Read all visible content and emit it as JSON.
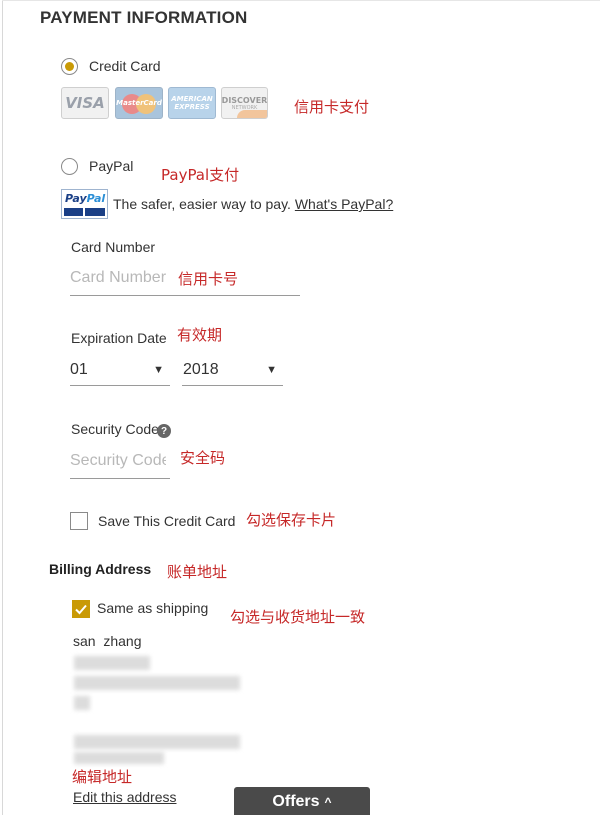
{
  "section_title": "PAYMENT INFORMATION",
  "payment_options": {
    "credit_card_label": "Credit Card",
    "paypal_label": "PayPal",
    "selected": "Credit Card"
  },
  "card_logos": {
    "visa": "VISA",
    "mastercard": "MasterCard",
    "amex_line1": "AMERICAN",
    "amex_line2": "EXPRESS",
    "discover": "DISCOVER",
    "discover_sub": "NETWORK"
  },
  "paypal": {
    "logo_text_1": "Pay",
    "logo_text_2": "Pal",
    "tagline": "The safer, easier way to pay.",
    "whats_link": "What's PayPal?"
  },
  "annotations": {
    "credit_card_pay": "信用卡支付",
    "paypal_pay": "PayPal支付",
    "card_number": "信用卡号",
    "expiry": "有效期",
    "security_code": "安全码",
    "save_card": "勾选保存卡片",
    "billing": "账单地址",
    "same_as_shipping": "勾选与收货地址一致",
    "edit_address": "编辑地址"
  },
  "card_number": {
    "label": "Card Number",
    "placeholder": "Card Number"
  },
  "expiration": {
    "label": "Expiration Date",
    "month": "01",
    "year": "2018"
  },
  "security_code": {
    "label": "Security Code",
    "help": "?",
    "placeholder": "Security Code"
  },
  "save_card": {
    "label": "Save This Credit Card",
    "checked": false
  },
  "billing": {
    "title": "Billing Address",
    "same_as_shipping_label": "Same as shipping",
    "same_as_shipping_checked": true,
    "name": "san  zhang",
    "edit_link": "Edit this address"
  },
  "offers": {
    "label": "Offers",
    "caret": "^"
  },
  "colors": {
    "accent": "#c99a06",
    "annotation": "#c62828",
    "offers_bg": "#4a4a4a"
  }
}
